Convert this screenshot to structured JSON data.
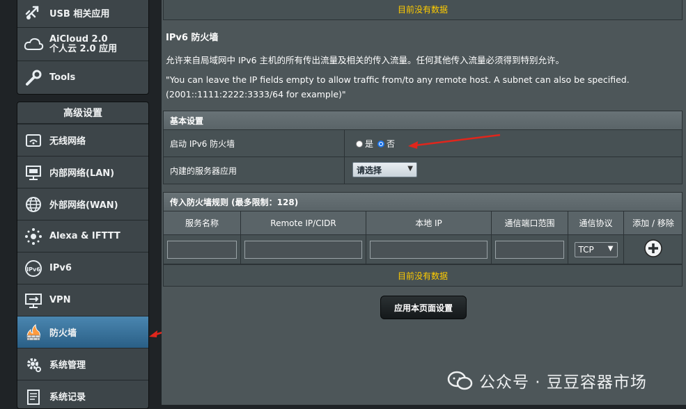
{
  "sidebar": {
    "top_items": [
      {
        "label": "USB 相关应用",
        "icon": "usb-icon"
      },
      {
        "label": "AiCloud 2.0",
        "label2": "个人云 2.0 应用",
        "icon": "cloud-icon"
      },
      {
        "label": "Tools",
        "icon": "wrench-icon"
      }
    ],
    "advanced_header": "高级设置",
    "advanced_items": [
      {
        "label": "无线网络",
        "icon": "wireless-icon"
      },
      {
        "label": "内部网络(LAN)",
        "icon": "lan-icon"
      },
      {
        "label": "外部网络(WAN)",
        "icon": "globe-icon"
      },
      {
        "label": "Alexa & IFTTT",
        "icon": "alexa-icon"
      },
      {
        "label": "IPv6",
        "icon": "ipv6-icon"
      },
      {
        "label": "VPN",
        "icon": "vpn-icon"
      },
      {
        "label": "防火墙",
        "icon": "firewall-icon",
        "active": true
      },
      {
        "label": "系统管理",
        "icon": "gear-icon"
      },
      {
        "label": "系统记录",
        "icon": "log-icon"
      }
    ]
  },
  "main": {
    "top_nodata": "目前没有数据",
    "title": "IPv6 防火墙",
    "desc1": "允许来自局域网中 IPv6 主机的所有传出流量及相关的传入流量。任何其他传入流量必须得到特别允许。",
    "desc2": "\"You can leave the IP fields empty to allow traffic from/to any remote host. A subnet can also be specified.",
    "desc3": "(2001::1111:2222:3333/64 for example)\"",
    "basic": {
      "header": "基本设置",
      "enable_label": "启动 IPv6 防火墙",
      "yes": "是",
      "no": "否",
      "selected": "no",
      "builtin_label": "内建的服务器应用",
      "builtin_select": "请选择"
    },
    "rules": {
      "header": "传入防火墙规则 (最多限制：128)",
      "columns": [
        "服务名称",
        "Remote IP/CIDR",
        "本地 IP",
        "通信端口范围",
        "通信协议",
        "添加 / 移除"
      ],
      "protocol_value": "TCP",
      "nodata": "目前没有数据"
    },
    "apply_button": "应用本页面设置"
  },
  "watermark": "公众号 · 豆豆容器市场",
  "colors": {
    "accent_yellow": "#ffcc00",
    "active_blue": "#3a78a6",
    "annotation_red": "#e0261c"
  }
}
